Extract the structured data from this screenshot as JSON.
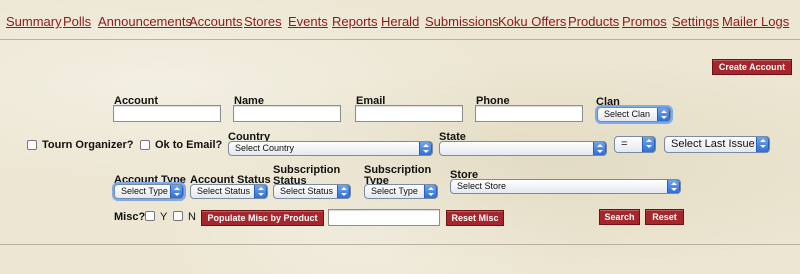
{
  "nav": [
    "Summary",
    "Polls",
    "Announcements",
    "Accounts",
    "Stores",
    "Events",
    "Reports",
    "Herald",
    "Submissions",
    "Koku Offers",
    "Products",
    "Promos",
    "Settings",
    "Mailer Logs"
  ],
  "create_account": "Create Account",
  "labels": {
    "account": "Account",
    "name": "Name",
    "email": "Email",
    "phone": "Phone",
    "clan": "Clan",
    "tourn_organizer": "Tourn Organizer?",
    "ok_to_email": "Ok to Email?",
    "country": "Country",
    "state": "State",
    "account_type": "Account Type",
    "account_status": "Account Status",
    "subscription_status": "Subscription Status",
    "subscription_type": "Subscription Type",
    "store": "Store",
    "misc": "Misc?",
    "y": "Y",
    "n": "N"
  },
  "selects": {
    "clan": "Select Clan",
    "country": "Select Country",
    "state": "",
    "operator": "=",
    "last_issue": "Select Last Issue",
    "account_type": "Select Type",
    "account_status": "Select Status",
    "subscription_status": "Select Status",
    "subscription_type": "Select Type",
    "store": "Select Store"
  },
  "buttons": {
    "populate_misc": "Populate Misc by Product",
    "reset_misc": "Reset Misc",
    "search": "Search",
    "reset": "Reset"
  }
}
